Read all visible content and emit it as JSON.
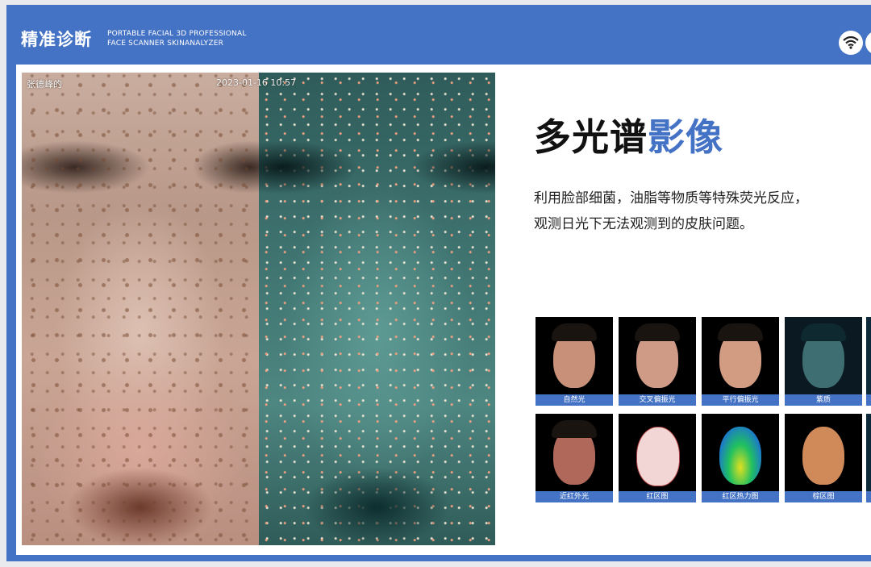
{
  "header": {
    "brand": "精准诊断",
    "tagline_line1": "PORTABLE FACIAL 3D PROFESSIONAL",
    "tagline_line2": "FACE SCANNER SKINANALYZER",
    "accent_color": "#4472c4",
    "icons": [
      "wifi-icon"
    ]
  },
  "photo": {
    "overlay_name": "张德峰的",
    "overlay_time": "2023-01-16 10:57"
  },
  "headline": {
    "part1": "多光谱",
    "part2": "影像"
  },
  "description": {
    "line1": "利用脸部细菌，油脂等物质等特殊荧光反应，",
    "line2": "观测日光下无法观测到的皮肤问题。"
  },
  "thumbnails": [
    {
      "label": "自然光",
      "face_color": "#c89078"
    },
    {
      "label": "交叉偏振光",
      "face_color": "#cf9a86"
    },
    {
      "label": "平行偏振光",
      "face_color": "#d29c82"
    },
    {
      "label": "紫质",
      "face_color": "#3e6e72"
    },
    {
      "label": "近红外光",
      "face_color": "#b0685a"
    },
    {
      "label": "红区图",
      "face_color": "#f2d6d6"
    },
    {
      "label": "红区热力图",
      "face_color": "#1c7ac8"
    },
    {
      "label": "棕区图",
      "face_color": "#d08a5a"
    }
  ]
}
